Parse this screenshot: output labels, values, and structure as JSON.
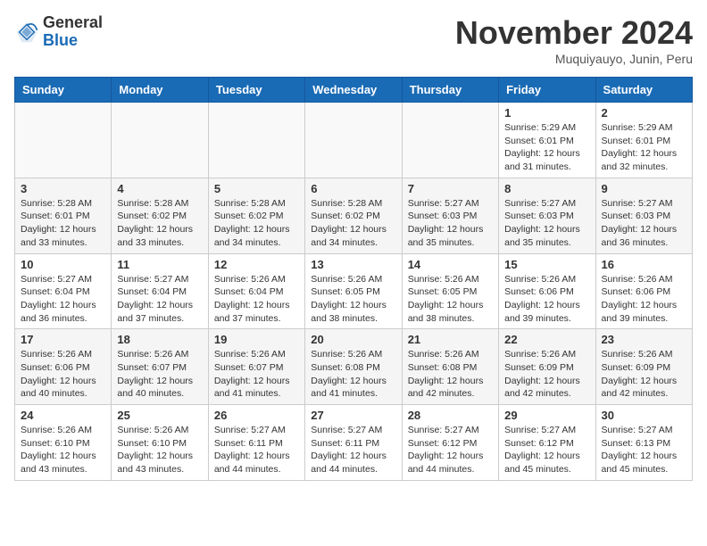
{
  "logo": {
    "general": "General",
    "blue": "Blue"
  },
  "header": {
    "title": "November 2024",
    "location": "Muquiyauyo, Junin, Peru"
  },
  "weekdays": [
    "Sunday",
    "Monday",
    "Tuesday",
    "Wednesday",
    "Thursday",
    "Friday",
    "Saturday"
  ],
  "weeks": [
    [
      {
        "day": "",
        "info": ""
      },
      {
        "day": "",
        "info": ""
      },
      {
        "day": "",
        "info": ""
      },
      {
        "day": "",
        "info": ""
      },
      {
        "day": "",
        "info": ""
      },
      {
        "day": "1",
        "info": "Sunrise: 5:29 AM\nSunset: 6:01 PM\nDaylight: 12 hours and 31 minutes."
      },
      {
        "day": "2",
        "info": "Sunrise: 5:29 AM\nSunset: 6:01 PM\nDaylight: 12 hours and 32 minutes."
      }
    ],
    [
      {
        "day": "3",
        "info": "Sunrise: 5:28 AM\nSunset: 6:01 PM\nDaylight: 12 hours and 33 minutes."
      },
      {
        "day": "4",
        "info": "Sunrise: 5:28 AM\nSunset: 6:02 PM\nDaylight: 12 hours and 33 minutes."
      },
      {
        "day": "5",
        "info": "Sunrise: 5:28 AM\nSunset: 6:02 PM\nDaylight: 12 hours and 34 minutes."
      },
      {
        "day": "6",
        "info": "Sunrise: 5:28 AM\nSunset: 6:02 PM\nDaylight: 12 hours and 34 minutes."
      },
      {
        "day": "7",
        "info": "Sunrise: 5:27 AM\nSunset: 6:03 PM\nDaylight: 12 hours and 35 minutes."
      },
      {
        "day": "8",
        "info": "Sunrise: 5:27 AM\nSunset: 6:03 PM\nDaylight: 12 hours and 35 minutes."
      },
      {
        "day": "9",
        "info": "Sunrise: 5:27 AM\nSunset: 6:03 PM\nDaylight: 12 hours and 36 minutes."
      }
    ],
    [
      {
        "day": "10",
        "info": "Sunrise: 5:27 AM\nSunset: 6:04 PM\nDaylight: 12 hours and 36 minutes."
      },
      {
        "day": "11",
        "info": "Sunrise: 5:27 AM\nSunset: 6:04 PM\nDaylight: 12 hours and 37 minutes."
      },
      {
        "day": "12",
        "info": "Sunrise: 5:26 AM\nSunset: 6:04 PM\nDaylight: 12 hours and 37 minutes."
      },
      {
        "day": "13",
        "info": "Sunrise: 5:26 AM\nSunset: 6:05 PM\nDaylight: 12 hours and 38 minutes."
      },
      {
        "day": "14",
        "info": "Sunrise: 5:26 AM\nSunset: 6:05 PM\nDaylight: 12 hours and 38 minutes."
      },
      {
        "day": "15",
        "info": "Sunrise: 5:26 AM\nSunset: 6:06 PM\nDaylight: 12 hours and 39 minutes."
      },
      {
        "day": "16",
        "info": "Sunrise: 5:26 AM\nSunset: 6:06 PM\nDaylight: 12 hours and 39 minutes."
      }
    ],
    [
      {
        "day": "17",
        "info": "Sunrise: 5:26 AM\nSunset: 6:06 PM\nDaylight: 12 hours and 40 minutes."
      },
      {
        "day": "18",
        "info": "Sunrise: 5:26 AM\nSunset: 6:07 PM\nDaylight: 12 hours and 40 minutes."
      },
      {
        "day": "19",
        "info": "Sunrise: 5:26 AM\nSunset: 6:07 PM\nDaylight: 12 hours and 41 minutes."
      },
      {
        "day": "20",
        "info": "Sunrise: 5:26 AM\nSunset: 6:08 PM\nDaylight: 12 hours and 41 minutes."
      },
      {
        "day": "21",
        "info": "Sunrise: 5:26 AM\nSunset: 6:08 PM\nDaylight: 12 hours and 42 minutes."
      },
      {
        "day": "22",
        "info": "Sunrise: 5:26 AM\nSunset: 6:09 PM\nDaylight: 12 hours and 42 minutes."
      },
      {
        "day": "23",
        "info": "Sunrise: 5:26 AM\nSunset: 6:09 PM\nDaylight: 12 hours and 42 minutes."
      }
    ],
    [
      {
        "day": "24",
        "info": "Sunrise: 5:26 AM\nSunset: 6:10 PM\nDaylight: 12 hours and 43 minutes."
      },
      {
        "day": "25",
        "info": "Sunrise: 5:26 AM\nSunset: 6:10 PM\nDaylight: 12 hours and 43 minutes."
      },
      {
        "day": "26",
        "info": "Sunrise: 5:27 AM\nSunset: 6:11 PM\nDaylight: 12 hours and 44 minutes."
      },
      {
        "day": "27",
        "info": "Sunrise: 5:27 AM\nSunset: 6:11 PM\nDaylight: 12 hours and 44 minutes."
      },
      {
        "day": "28",
        "info": "Sunrise: 5:27 AM\nSunset: 6:12 PM\nDaylight: 12 hours and 44 minutes."
      },
      {
        "day": "29",
        "info": "Sunrise: 5:27 AM\nSunset: 6:12 PM\nDaylight: 12 hours and 45 minutes."
      },
      {
        "day": "30",
        "info": "Sunrise: 5:27 AM\nSunset: 6:13 PM\nDaylight: 12 hours and 45 minutes."
      }
    ]
  ]
}
